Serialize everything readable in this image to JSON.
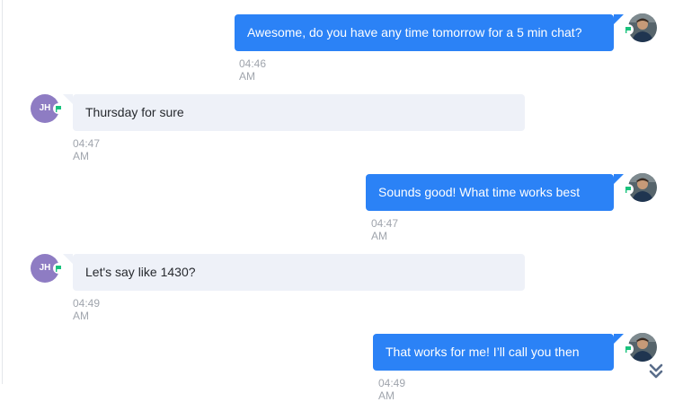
{
  "conversation": {
    "messages": [
      {
        "direction": "outgoing",
        "text": "Awesome, do you have any time tomorrow for a 5 min chat?",
        "time": "04:46 AM"
      },
      {
        "direction": "incoming",
        "initials": "JH",
        "text": "Thursday for sure",
        "time": "04:47 AM"
      },
      {
        "direction": "outgoing",
        "text": "Sounds good! What time works best",
        "time": "04:47 AM"
      },
      {
        "direction": "incoming",
        "initials": "JH",
        "text": "Let's say like 1430?",
        "time": "04:49 AM"
      },
      {
        "direction": "outgoing",
        "text": "That works for me! I’ll call you then",
        "time": "04:49 AM"
      }
    ]
  },
  "colors": {
    "outgoing_bubble": "#2b82f6",
    "incoming_bubble": "#eef1f8",
    "avatar_initials_bg": "#8e7cc3",
    "channel_badge": "#19c37d",
    "timestamp": "#a0a5ad"
  },
  "icons": {
    "channel": "chat-flag-icon",
    "scroll": "double-chevron-down-icon"
  }
}
